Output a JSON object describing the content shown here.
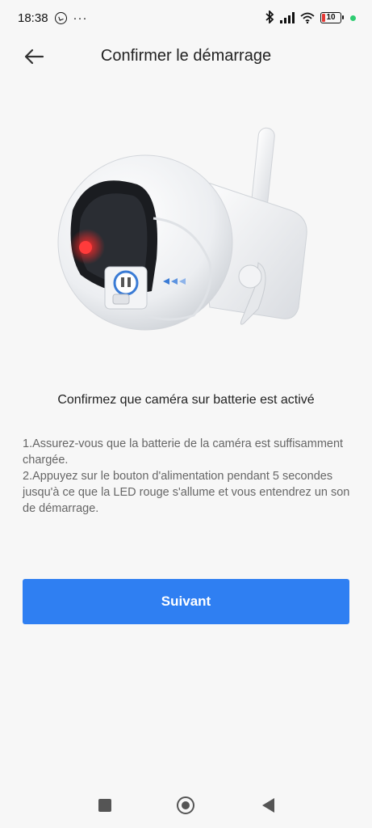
{
  "status_bar": {
    "time": "18:38",
    "more": "···",
    "battery_level": "10",
    "icons": [
      "whatsapp-icon",
      "bluetooth-icon",
      "signal-icon",
      "wifi-icon",
      "battery-icon"
    ]
  },
  "header": {
    "title": "Confirmer le démarrage",
    "back_icon": "arrow-left-icon"
  },
  "content": {
    "heading": "Confirmez que caméra sur batterie est activé",
    "instruction_1": "1.Assurez-vous que la batterie de la caméra est suffisamment chargée.",
    "instruction_2": "2.Appuyez sur le bouton d'alimentation pendant 5 secondes jusqu'à ce que la LED rouge s'allume et vous entendrez un son de démarrage."
  },
  "actions": {
    "next_label": "Suivant"
  },
  "colors": {
    "accent": "#2f7ff2",
    "background": "#f7f7f7",
    "text_secondary": "#666666"
  },
  "nav_bar": {
    "buttons": [
      "recents-button",
      "home-button",
      "back-button"
    ]
  }
}
